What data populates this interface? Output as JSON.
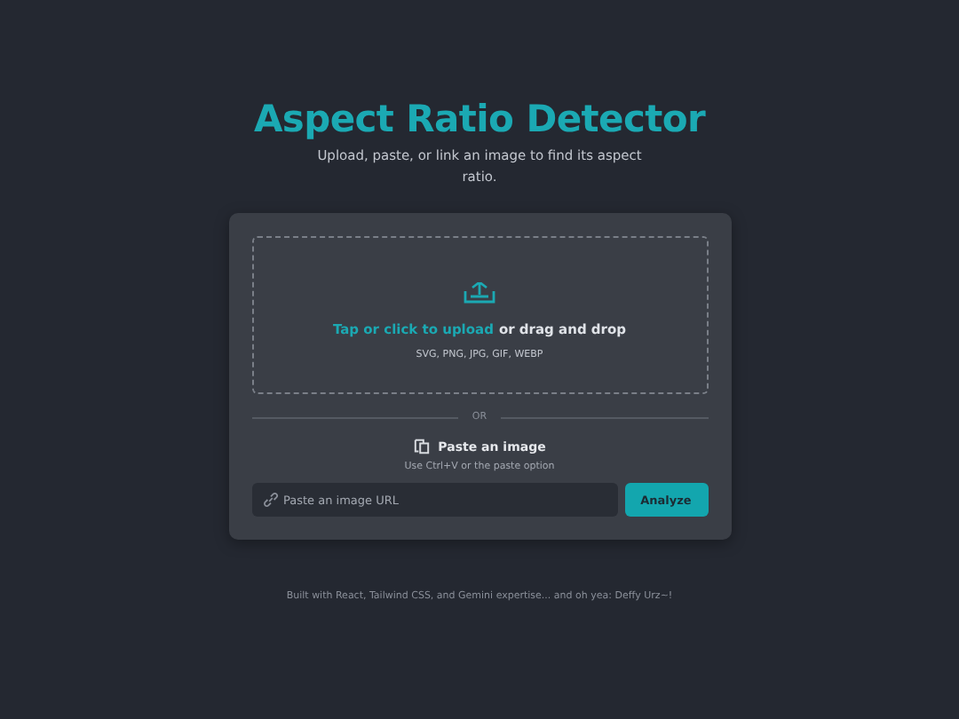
{
  "header": {
    "title": "Aspect Ratio Detector",
    "subtitle": "Upload, paste, or link an image to find its aspect ratio."
  },
  "dropzone": {
    "link": "Tap or click to upload",
    "text": "or drag and drop",
    "formats": "SVG, PNG, JPG, GIF, WEBP"
  },
  "divider": "OR",
  "paste": {
    "label": "Paste an image",
    "hint": "Use Ctrl+V or the paste option"
  },
  "url_field": {
    "placeholder": "Paste an image URL"
  },
  "analyze_button": "Analyze",
  "footer": "Built with React, Tailwind CSS, and Gemini expertise... and oh yea: Deffy Urz~!"
}
